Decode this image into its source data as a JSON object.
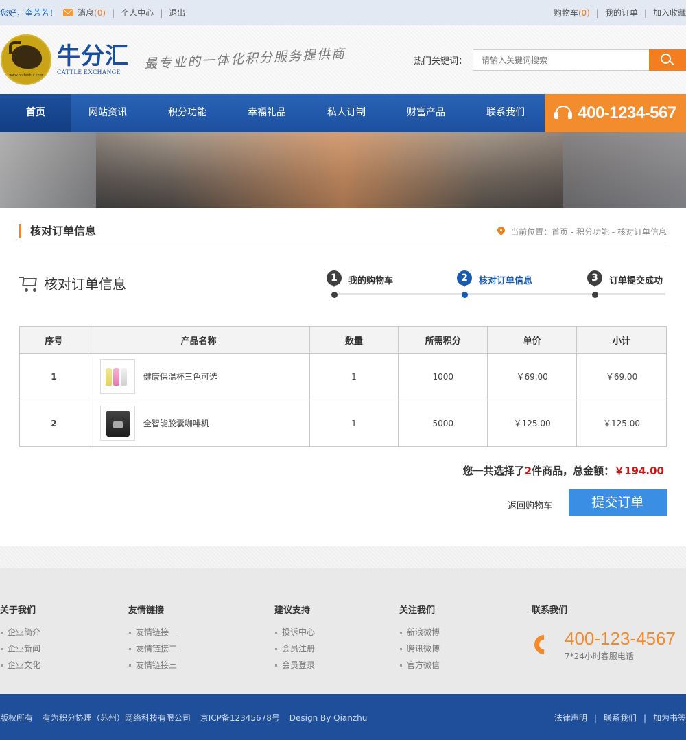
{
  "topbar": {
    "greeting": "您好，奎芳芳！",
    "messages_label": "消息",
    "messages_count": "(0)",
    "user_center": "个人中心",
    "logout": "退出",
    "cart_label": "购物车",
    "cart_count": "(0)",
    "my_orders": "我的订单",
    "add_favorite": "加入收藏",
    "sep": "|"
  },
  "header": {
    "logo_cn": "牛分汇",
    "logo_en": "CATTLE EXCHANGE",
    "logo_badge_text": "www.niufenhui.com",
    "slogan": "最专业的一体化积分服务提供商",
    "search_label": "热门关键词：",
    "search_placeholder": "请输入关键词搜索"
  },
  "nav": {
    "items": [
      "首页",
      "网站资讯",
      "积分功能",
      "幸福礼品",
      "私人订制",
      "财富产品",
      "联系我们"
    ],
    "hotline": "400-1234-567"
  },
  "crumb": {
    "title": "核对订单信息",
    "prefix": "当前位置：",
    "path": "首页 - 积分功能 - 核对订单信息"
  },
  "order": {
    "heading": "核对订单信息",
    "steps": [
      {
        "num": "1",
        "label": "我的购物车"
      },
      {
        "num": "2",
        "label": "核对订单信息"
      },
      {
        "num": "3",
        "label": "订单提交成功"
      }
    ],
    "current_step": 2,
    "columns": [
      "序号",
      "产品名称",
      "数量",
      "所需积分",
      "单价",
      "小计"
    ],
    "rows": [
      {
        "idx": "1",
        "name": "健康保温杯三色可选",
        "qty": "1",
        "points": "1000",
        "price": "￥69.00",
        "subtotal": "￥69.00"
      },
      {
        "idx": "2",
        "name": "全智能胶囊咖啡机",
        "qty": "1",
        "points": "5000",
        "price": "￥125.00",
        "subtotal": "￥125.00"
      }
    ],
    "summary_pre": "您一共选择了",
    "summary_count": "2",
    "summary_mid": "件商品，总金额：",
    "summary_amount": "￥194.00",
    "back_label": "返回购物车",
    "submit_label": "提交订单"
  },
  "footer": {
    "cols": [
      {
        "title": "关于我们",
        "items": [
          "企业简介",
          "企业新闻",
          "企业文化"
        ]
      },
      {
        "title": "友情链接",
        "items": [
          "友情链接一",
          "友情链接二",
          "友情链接三"
        ]
      },
      {
        "title": "建议支持",
        "items": [
          "投诉中心",
          "会员注册",
          "会员登录"
        ]
      },
      {
        "title": "关注我们",
        "items": [
          "新浪微博",
          "腾讯微博",
          "官方微信"
        ]
      }
    ],
    "contact_title": "联系我们",
    "contact_phone": "400-123-4567",
    "contact_sub": "7*24小时客服电话"
  },
  "copyright": {
    "rights": "版权所有",
    "company": "有为积分协理（苏州）网络科技有限公司",
    "icp": "京ICP备12345678号",
    "design": "Design By Qianzhu",
    "links": [
      "法律声明",
      "联系我们",
      "加为书签"
    ]
  },
  "colors": {
    "brand_blue": "#1c4f9f",
    "accent_orange": "#f47d20",
    "price_red": "#d01414",
    "submit_blue": "#3a8ee3"
  }
}
